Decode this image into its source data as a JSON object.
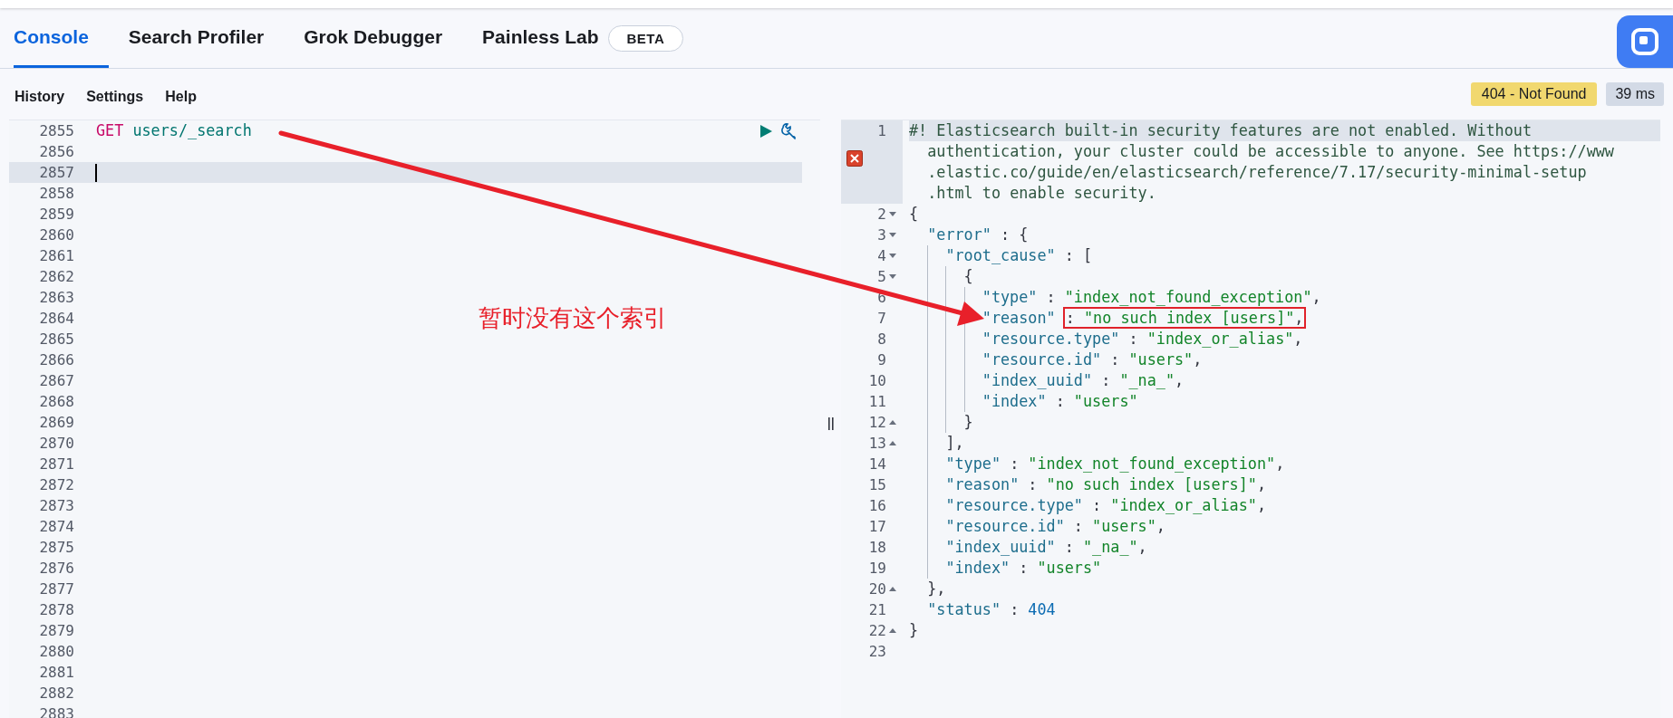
{
  "tabs": [
    {
      "label": "Console",
      "selected": true
    },
    {
      "label": "Search Profiler",
      "selected": false
    },
    {
      "label": "Grok Debugger",
      "selected": false
    },
    {
      "label": "Painless Lab",
      "selected": false,
      "badge": "BETA"
    }
  ],
  "toolbar": [
    "History",
    "Settings",
    "Help"
  ],
  "response_status": {
    "status": "404 - Not Found",
    "time": "39 ms"
  },
  "request_editor": {
    "lines": [
      {
        "number": "2855",
        "active": false,
        "request_actions": true,
        "tokens": [
          {
            "kind": "method",
            "text": "GET"
          },
          {
            "kind": "path",
            "text": " users/_search"
          }
        ]
      },
      {
        "number": "2856",
        "active": false
      },
      {
        "number": "2857",
        "active": true
      },
      {
        "number": "2858",
        "active": false
      },
      {
        "number": "2859",
        "active": false
      },
      {
        "number": "2860",
        "active": false
      },
      {
        "number": "2861",
        "active": false
      },
      {
        "number": "2862",
        "active": false
      },
      {
        "number": "2863",
        "active": false
      },
      {
        "number": "2864",
        "active": false
      },
      {
        "number": "2865",
        "active": false
      },
      {
        "number": "2866",
        "active": false
      },
      {
        "number": "2867",
        "active": false
      },
      {
        "number": "2868",
        "active": false
      },
      {
        "number": "2869",
        "active": false
      },
      {
        "number": "2870",
        "active": false
      },
      {
        "number": "2871",
        "active": false
      },
      {
        "number": "2872",
        "active": false
      },
      {
        "number": "2873",
        "active": false
      },
      {
        "number": "2874",
        "active": false
      },
      {
        "number": "2875",
        "active": false
      },
      {
        "number": "2876",
        "active": false
      },
      {
        "number": "2877",
        "active": false
      },
      {
        "number": "2878",
        "active": false
      },
      {
        "number": "2879",
        "active": false
      },
      {
        "number": "2880",
        "active": false
      },
      {
        "number": "2881",
        "active": false
      },
      {
        "number": "2882",
        "active": false
      },
      {
        "number": "2883",
        "active": false
      }
    ]
  },
  "response_editor": {
    "lines": [
      {
        "number": "1",
        "kind": "comment",
        "active": true,
        "error": true,
        "rows": [
          "#! Elasticsearch built-in security features are not enabled. Without",
          "authentication, your cluster could be accessible to anyone. See https://www",
          ".elastic.co/guide/en/elasticsearch/reference/7.17/security-minimal-setup",
          ".html to enable security."
        ]
      },
      {
        "number": "2",
        "kind": "code",
        "expanded": true,
        "tokens": [
          {
            "kind": "punct",
            "text": "{"
          }
        ]
      },
      {
        "number": "3",
        "kind": "code",
        "expanded": true,
        "tokens": [
          {
            "kind": "key",
            "text": "  \"error\""
          },
          {
            "kind": "punct",
            "text": " : {"
          }
        ]
      },
      {
        "number": "4",
        "kind": "code",
        "expanded": true,
        "tokens": [
          {
            "kind": "key",
            "text": "    \"root_cause\""
          },
          {
            "kind": "punct",
            "text": " : ["
          }
        ]
      },
      {
        "number": "5",
        "kind": "code",
        "expanded": true,
        "tokens": [
          {
            "kind": "punct",
            "text": "      {"
          }
        ]
      },
      {
        "number": "6",
        "kind": "code",
        "tokens": [
          {
            "kind": "key",
            "text": "        \"type\""
          },
          {
            "kind": "punct",
            "text": " : "
          },
          {
            "kind": "string",
            "text": "\"index_not_found_exception\""
          },
          {
            "kind": "punct",
            "text": ","
          }
        ]
      },
      {
        "number": "7",
        "kind": "code",
        "tokens": [
          {
            "kind": "key",
            "text": "        \"reason\" "
          },
          {
            "kind": "annotation_box",
            "tokens": [
              {
                "kind": "punct",
                "text": ": "
              },
              {
                "kind": "string",
                "text": "\"no such index [users]\""
              },
              {
                "kind": "punct",
                "text": ","
              }
            ]
          }
        ]
      },
      {
        "number": "8",
        "kind": "code",
        "tokens": [
          {
            "kind": "key",
            "text": "        \"resource.type\""
          },
          {
            "kind": "punct",
            "text": " : "
          },
          {
            "kind": "string",
            "text": "\"index_or_alias\""
          },
          {
            "kind": "punct",
            "text": ","
          }
        ]
      },
      {
        "number": "9",
        "kind": "code",
        "tokens": [
          {
            "kind": "key",
            "text": "        \"resource.id\""
          },
          {
            "kind": "punct",
            "text": " : "
          },
          {
            "kind": "string",
            "text": "\"users\""
          },
          {
            "kind": "punct",
            "text": ","
          }
        ]
      },
      {
        "number": "10",
        "kind": "code",
        "tokens": [
          {
            "kind": "key",
            "text": "        \"index_uuid\""
          },
          {
            "kind": "punct",
            "text": " : "
          },
          {
            "kind": "string",
            "text": "\"_na_\""
          },
          {
            "kind": "punct",
            "text": ","
          }
        ]
      },
      {
        "number": "11",
        "kind": "code",
        "tokens": [
          {
            "kind": "key",
            "text": "        \"index\""
          },
          {
            "kind": "punct",
            "text": " : "
          },
          {
            "kind": "string",
            "text": "\"users\""
          }
        ]
      },
      {
        "number": "12",
        "kind": "code",
        "expanded": false,
        "tokens": [
          {
            "kind": "punct",
            "text": "      }"
          }
        ]
      },
      {
        "number": "13",
        "kind": "code",
        "expanded": false,
        "tokens": [
          {
            "kind": "punct",
            "text": "    ],"
          }
        ]
      },
      {
        "number": "14",
        "kind": "code",
        "tokens": [
          {
            "kind": "key",
            "text": "    \"type\""
          },
          {
            "kind": "punct",
            "text": " : "
          },
          {
            "kind": "string",
            "text": "\"index_not_found_exception\""
          },
          {
            "kind": "punct",
            "text": ","
          }
        ]
      },
      {
        "number": "15",
        "kind": "code",
        "tokens": [
          {
            "kind": "key",
            "text": "    \"reason\""
          },
          {
            "kind": "punct",
            "text": " : "
          },
          {
            "kind": "string",
            "text": "\"no such index [users]\""
          },
          {
            "kind": "punct",
            "text": ","
          }
        ]
      },
      {
        "number": "16",
        "kind": "code",
        "tokens": [
          {
            "kind": "key",
            "text": "    \"resource.type\""
          },
          {
            "kind": "punct",
            "text": " : "
          },
          {
            "kind": "string",
            "text": "\"index_or_alias\""
          },
          {
            "kind": "punct",
            "text": ","
          }
        ]
      },
      {
        "number": "17",
        "kind": "code",
        "tokens": [
          {
            "kind": "key",
            "text": "    \"resource.id\""
          },
          {
            "kind": "punct",
            "text": " : "
          },
          {
            "kind": "string",
            "text": "\"users\""
          },
          {
            "kind": "punct",
            "text": ","
          }
        ]
      },
      {
        "number": "18",
        "kind": "code",
        "tokens": [
          {
            "kind": "key",
            "text": "    \"index_uuid\""
          },
          {
            "kind": "punct",
            "text": " : "
          },
          {
            "kind": "string",
            "text": "\"_na_\""
          },
          {
            "kind": "punct",
            "text": ","
          }
        ]
      },
      {
        "number": "19",
        "kind": "code",
        "tokens": [
          {
            "kind": "key",
            "text": "    \"index\""
          },
          {
            "kind": "punct",
            "text": " : "
          },
          {
            "kind": "string",
            "text": "\"users\""
          }
        ]
      },
      {
        "number": "20",
        "kind": "code",
        "expanded": false,
        "tokens": [
          {
            "kind": "punct",
            "text": "  },"
          }
        ]
      },
      {
        "number": "21",
        "kind": "code",
        "tokens": [
          {
            "kind": "key",
            "text": "  \"status\""
          },
          {
            "kind": "punct",
            "text": " : "
          },
          {
            "kind": "number",
            "text": "404"
          }
        ]
      },
      {
        "number": "22",
        "kind": "code",
        "expanded": false,
        "tokens": [
          {
            "kind": "punct",
            "text": "}"
          }
        ]
      },
      {
        "number": "23",
        "kind": "code"
      }
    ]
  },
  "annotation": {
    "text": "暂时没有这个索引"
  }
}
